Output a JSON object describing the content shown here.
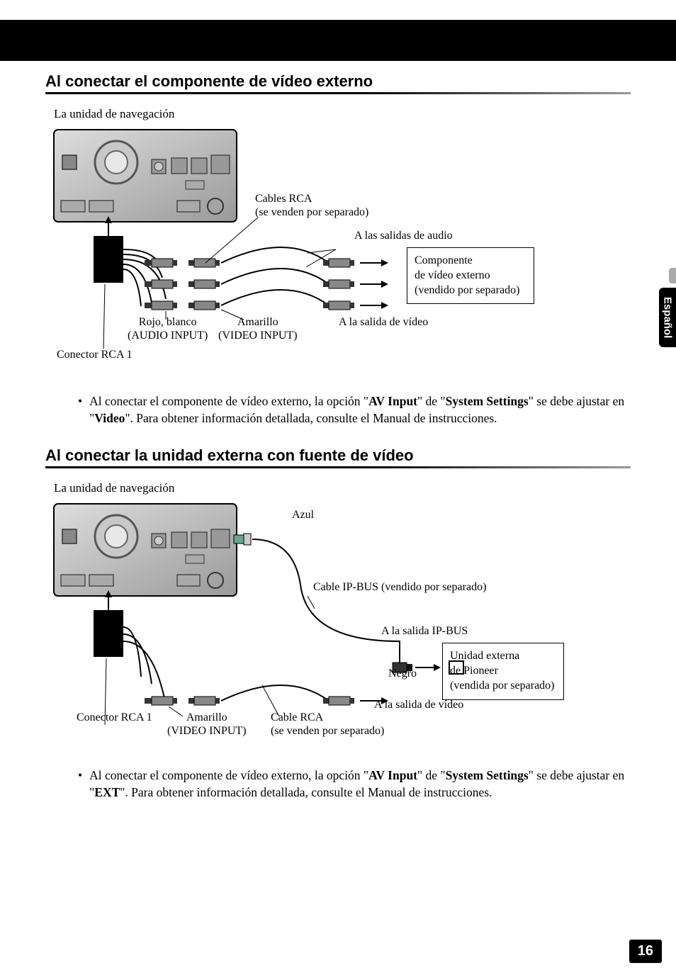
{
  "side_tab": "Español",
  "page_number": "16",
  "section1": {
    "heading": "Al conectar el componente de vídeo externo",
    "nav_unit_label": "La unidad de navegación",
    "labels": {
      "rca_cables": "Cables RCA",
      "rca_cables_sub": "(se venden por separado)",
      "audio_outputs": "A las salidas de audio",
      "video_output": "A la salida de vídeo",
      "red_white": "Rojo, blanco",
      "audio_input": "(AUDIO INPUT)",
      "yellow": "Amarillo",
      "video_input": "(VIDEO INPUT)",
      "rca_connector": "Conector RCA 1",
      "component_box_l1": "Componente",
      "component_box_l2": "de vídeo externo",
      "component_box_l3": "(vendido por separado)"
    },
    "note": {
      "pre1": "Al conectar el componente de vídeo externo, la opción \"",
      "bold1": "AV Input",
      "mid1": "\" de \"",
      "bold2": "System Settings",
      "mid2": "\" se debe ajustar en \"",
      "bold3": "Video",
      "post": "\". Para obtener información detallada, consulte el Manual de instrucciones."
    }
  },
  "section2": {
    "heading": "Al conectar la unidad externa con fuente de vídeo",
    "nav_unit_label": "La unidad de navegación",
    "labels": {
      "blue": "Azul",
      "ipbus_cable": "Cable IP-BUS (vendido por separado)",
      "ipbus_output": "A la salida IP-BUS",
      "black": "Negro",
      "external_box_l1": "Unidad externa",
      "external_box_l2": "de Pioneer",
      "external_box_l3": "(vendida por separado)",
      "video_output": "A la salida de vídeo",
      "rca_connector": "Conector RCA 1",
      "yellow": "Amarillo",
      "video_input": "(VIDEO INPUT)",
      "rca_cable": "Cable RCA",
      "rca_cable_sub": "(se venden por separado)"
    },
    "note": {
      "pre1": "Al conectar el componente de vídeo externo, la opción \"",
      "bold1": "AV Input",
      "mid1": "\" de \"",
      "bold2": "System Settings",
      "mid2": "\" se debe ajustar en \"",
      "bold3": "EXT",
      "post": "\". Para obtener información detallada, consulte el Manual de instrucciones."
    }
  }
}
